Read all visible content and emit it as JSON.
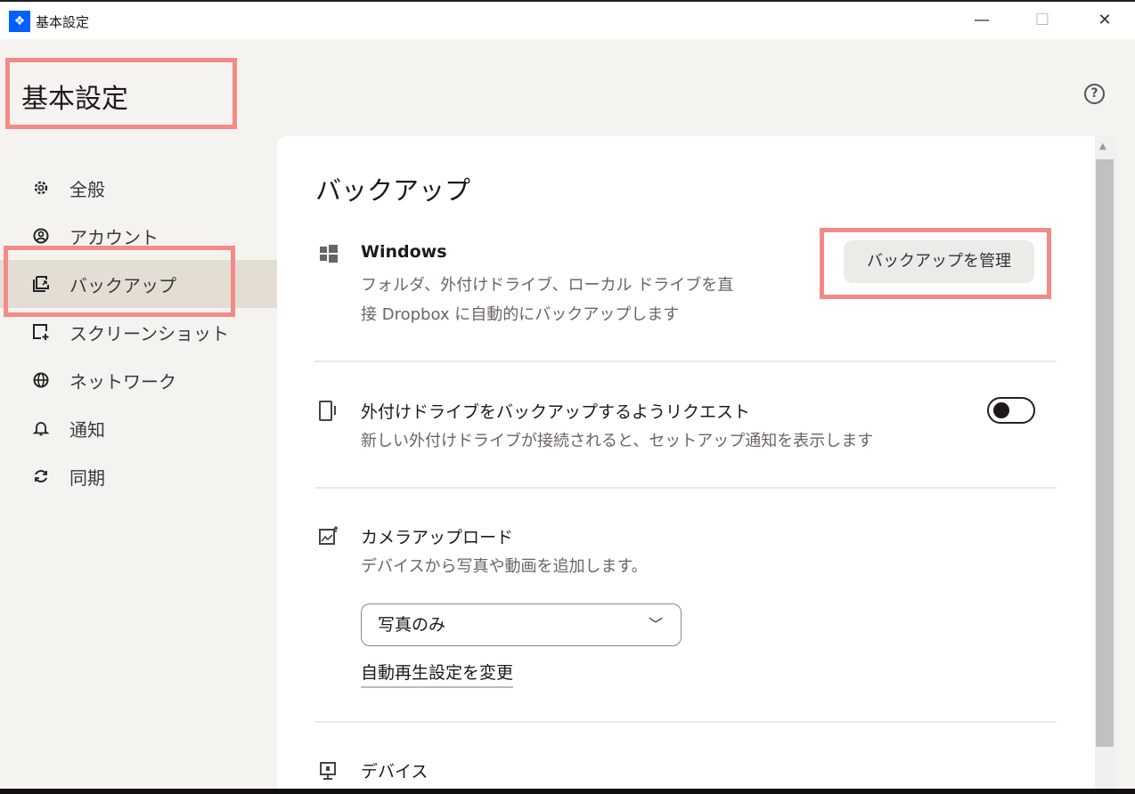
{
  "window": {
    "title": "基本設定",
    "minimize": "—",
    "maximize": "☐",
    "close": "✕"
  },
  "page": {
    "title": "基本設定",
    "help": "?"
  },
  "nav": {
    "items": [
      {
        "label": "全般",
        "icon": "gear-icon"
      },
      {
        "label": "アカウント",
        "icon": "account-icon"
      },
      {
        "label": "バックアップ",
        "icon": "backup-icon"
      },
      {
        "label": "スクリーンショット",
        "icon": "screenshot-icon"
      },
      {
        "label": "ネットワーク",
        "icon": "globe-icon"
      },
      {
        "label": "通知",
        "icon": "bell-icon"
      },
      {
        "label": "同期",
        "icon": "sync-icon"
      }
    ],
    "active": "バックアップ"
  },
  "main": {
    "section_title": "バックアップ",
    "windows": {
      "title": "Windows",
      "desc1": "フォルダ、外付けドライブ、ローカル ドライブを直",
      "desc2": "接 Dropbox に自動的にバックアップします",
      "button": "バックアップを管理"
    },
    "external": {
      "title": "外付けドライブをバックアップするようリクエスト",
      "desc": "新しい外付けドライブが接続されると、セットアップ通知を表示します",
      "toggle_on": false
    },
    "camera": {
      "title": "カメラアップロード",
      "desc": "デバイスから写真や動画を追加します。",
      "select_value": "写真のみ",
      "link": "自動再生設定を変更"
    },
    "devices": {
      "title": "デバイス"
    }
  },
  "colors": {
    "highlight": "#f48a88",
    "brand": "#0061fe"
  }
}
